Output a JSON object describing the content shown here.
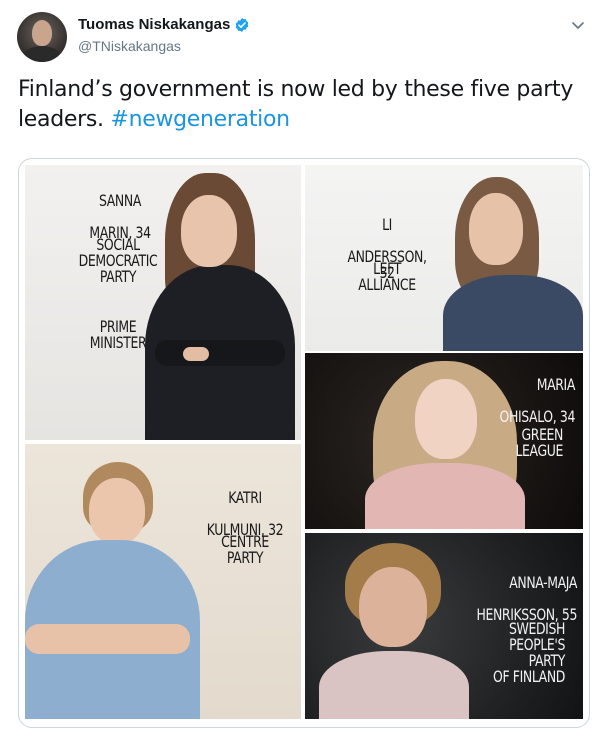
{
  "author": {
    "name": "Tuomas Niskakangas",
    "handle": "@TNiskakangas",
    "verified": true
  },
  "tweet": {
    "text": "Finland’s government is now led by these five party leaders. ",
    "hashtag": "#newgeneration"
  },
  "icons": {
    "verified": "verified-badge-icon",
    "menu": "chevron-down-icon"
  },
  "colors": {
    "hashtag": "#1b95e0",
    "verified": "#1da1f2",
    "handle": "#657786"
  },
  "leaders": [
    {
      "name_line1": "SANNA",
      "name_line2": "MARIN, 34",
      "party": "SOCIAL\nDEMOCRATIC\nPARTY",
      "role": "PRIME\nMINISTER"
    },
    {
      "name_line1": "LI",
      "name_line2": "ANDERSSON, 32",
      "party": "LEFT\nALLIANCE"
    },
    {
      "name_line1": "MARIA",
      "name_line2": "OHISALO, 34",
      "party": "GREEN\nLEAGUE"
    },
    {
      "name_line1": "KATRI",
      "name_line2": "KULMUNI, 32",
      "party": "CENTRE\nPARTY"
    },
    {
      "name_line1": "ANNA-MAJA",
      "name_line2": "HENRIKSSON, 55",
      "party": "SWEDISH\nPEOPLE'S\nPARTY\nOF FINLAND"
    }
  ]
}
